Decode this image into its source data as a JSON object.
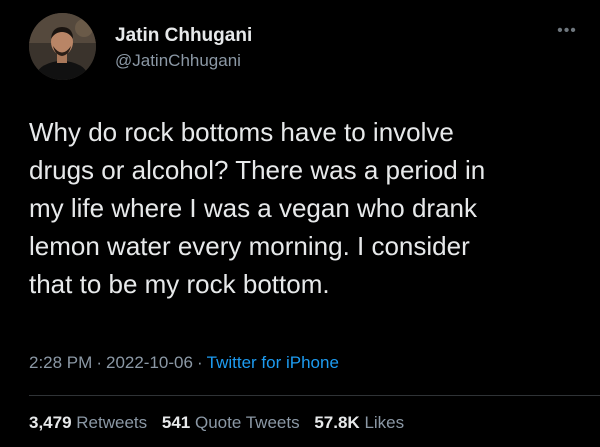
{
  "tweet": {
    "author": {
      "name": "Jatin Chhugani",
      "handle": "@JatinChhugani"
    },
    "more_icon": "more-horizontal-icon",
    "text_lines": [
      "Why do rock bottoms have to involve",
      "drugs or alcohol? There was a period in",
      "my life where I was a vegan who drank",
      "lemon water every morning. I consider",
      "that to be my rock bottom."
    ],
    "time": "2:28 PM",
    "date": "2022-10-06",
    "separator": "·",
    "source": "Twitter for iPhone",
    "stats": {
      "retweets_count": "3,479",
      "retweets_label": "Retweets",
      "quotes_count": "541",
      "quotes_label": "Quote Tweets",
      "likes_count": "57.8K",
      "likes_label": "Likes"
    },
    "colors": {
      "background": "#000000",
      "primary_text": "#e7e9ea",
      "secondary_text": "#8b98a5",
      "link": "#1d9bf0"
    }
  }
}
